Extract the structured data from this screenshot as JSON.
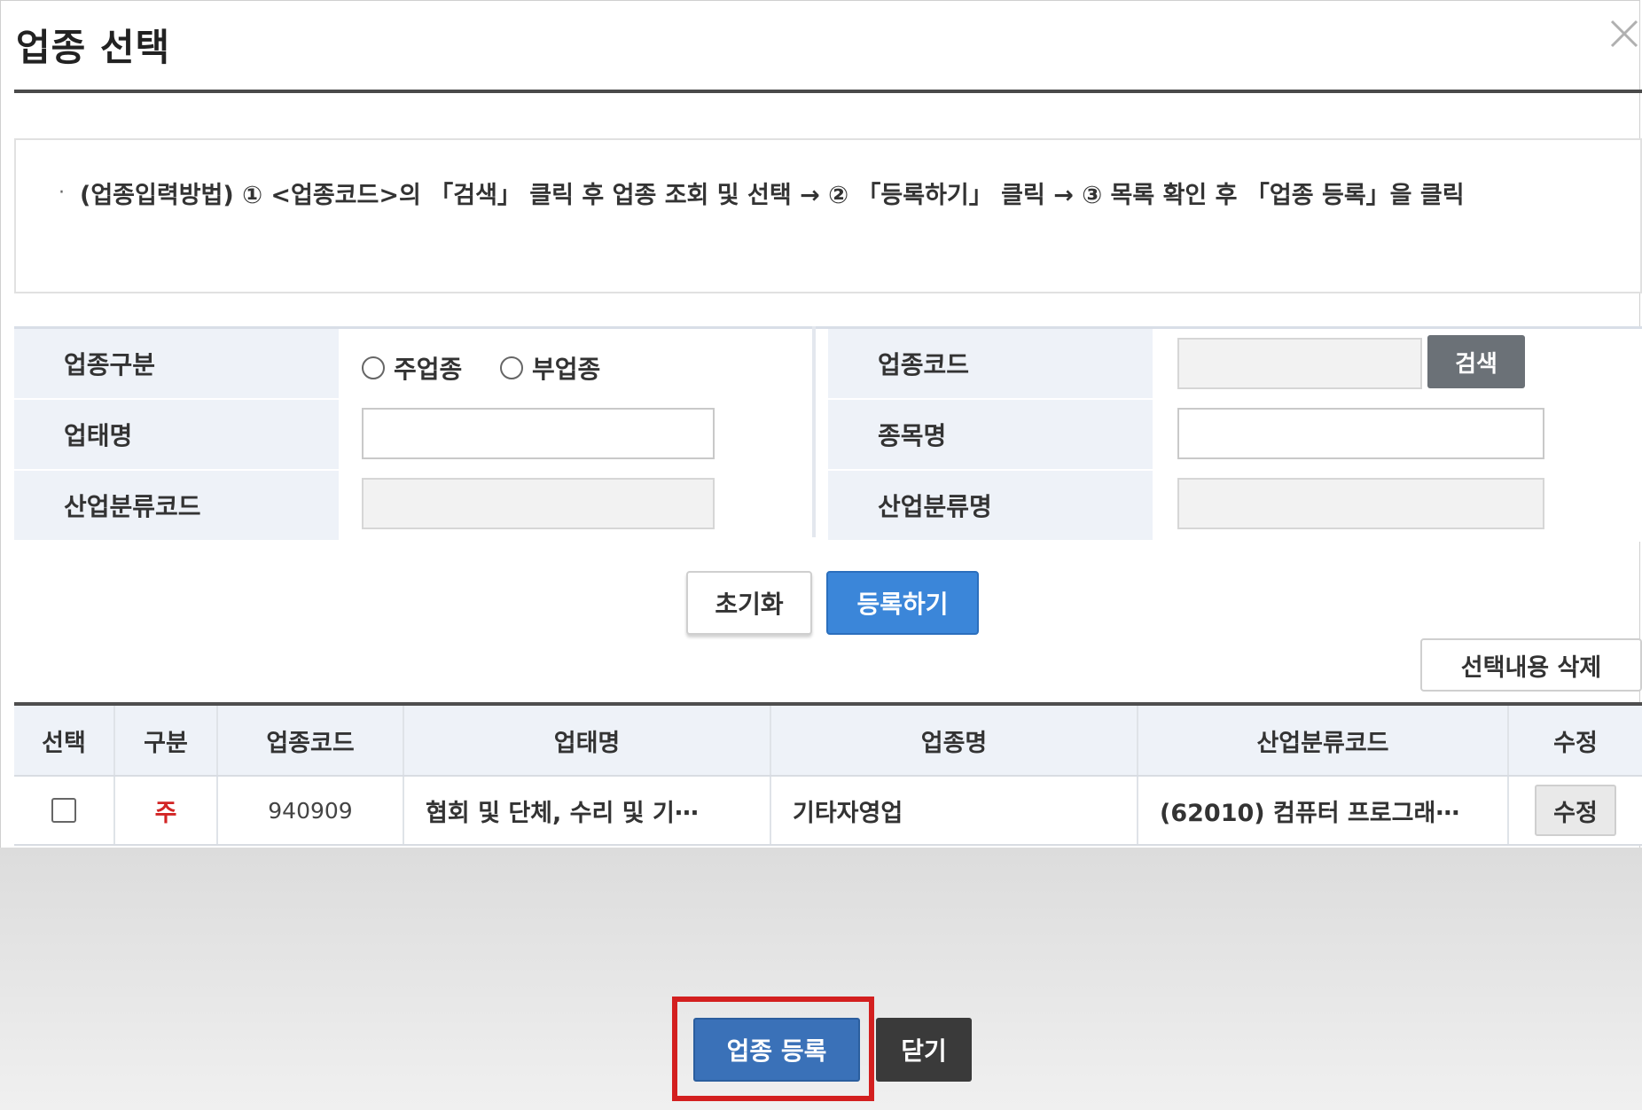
{
  "dialog": {
    "title": "업종 선택",
    "close_icon": "close-icon"
  },
  "notice": {
    "bullet": "·",
    "text": "(업종입력방법) ① <업종코드>의 「검색」 클릭 후 업종 조회 및 선택 → ② 「등록하기」 클릭 → ③ 목록 확인 후 「업종 등록」을 클릭"
  },
  "form": {
    "biz_type_label": "업종구분",
    "radio_main": "주업종",
    "radio_sub": "부업종",
    "biz_code_label": "업종코드",
    "search_button": "검색",
    "business_name_label": "업태명",
    "item_name_label": "종목명",
    "industry_code_label": "산업분류코드",
    "industry_name_label": "산업분류명"
  },
  "actions": {
    "reset": "초기화",
    "add": "등록하기",
    "delete_selected": "선택내용 삭제"
  },
  "table": {
    "headers": [
      "선택",
      "구분",
      "업종코드",
      "업태명",
      "업종명",
      "산업분류코드",
      "수정"
    ],
    "rows": [
      {
        "type": "주",
        "code": "940909",
        "business": "협회 및 단체, 수리 및 기⋯",
        "item": "기타자영업",
        "industry": "(62010) 컴퓨터 프로그래⋯",
        "edit": "수정"
      }
    ]
  },
  "footer": {
    "register": "업종 등록",
    "close": "닫기"
  },
  "colors": {
    "primary_button": "#3b86d9",
    "register_button": "#3a71b8",
    "close_button": "#3a3a3a",
    "highlight": "#d31f1f",
    "label_bg": "#eef2f8"
  }
}
